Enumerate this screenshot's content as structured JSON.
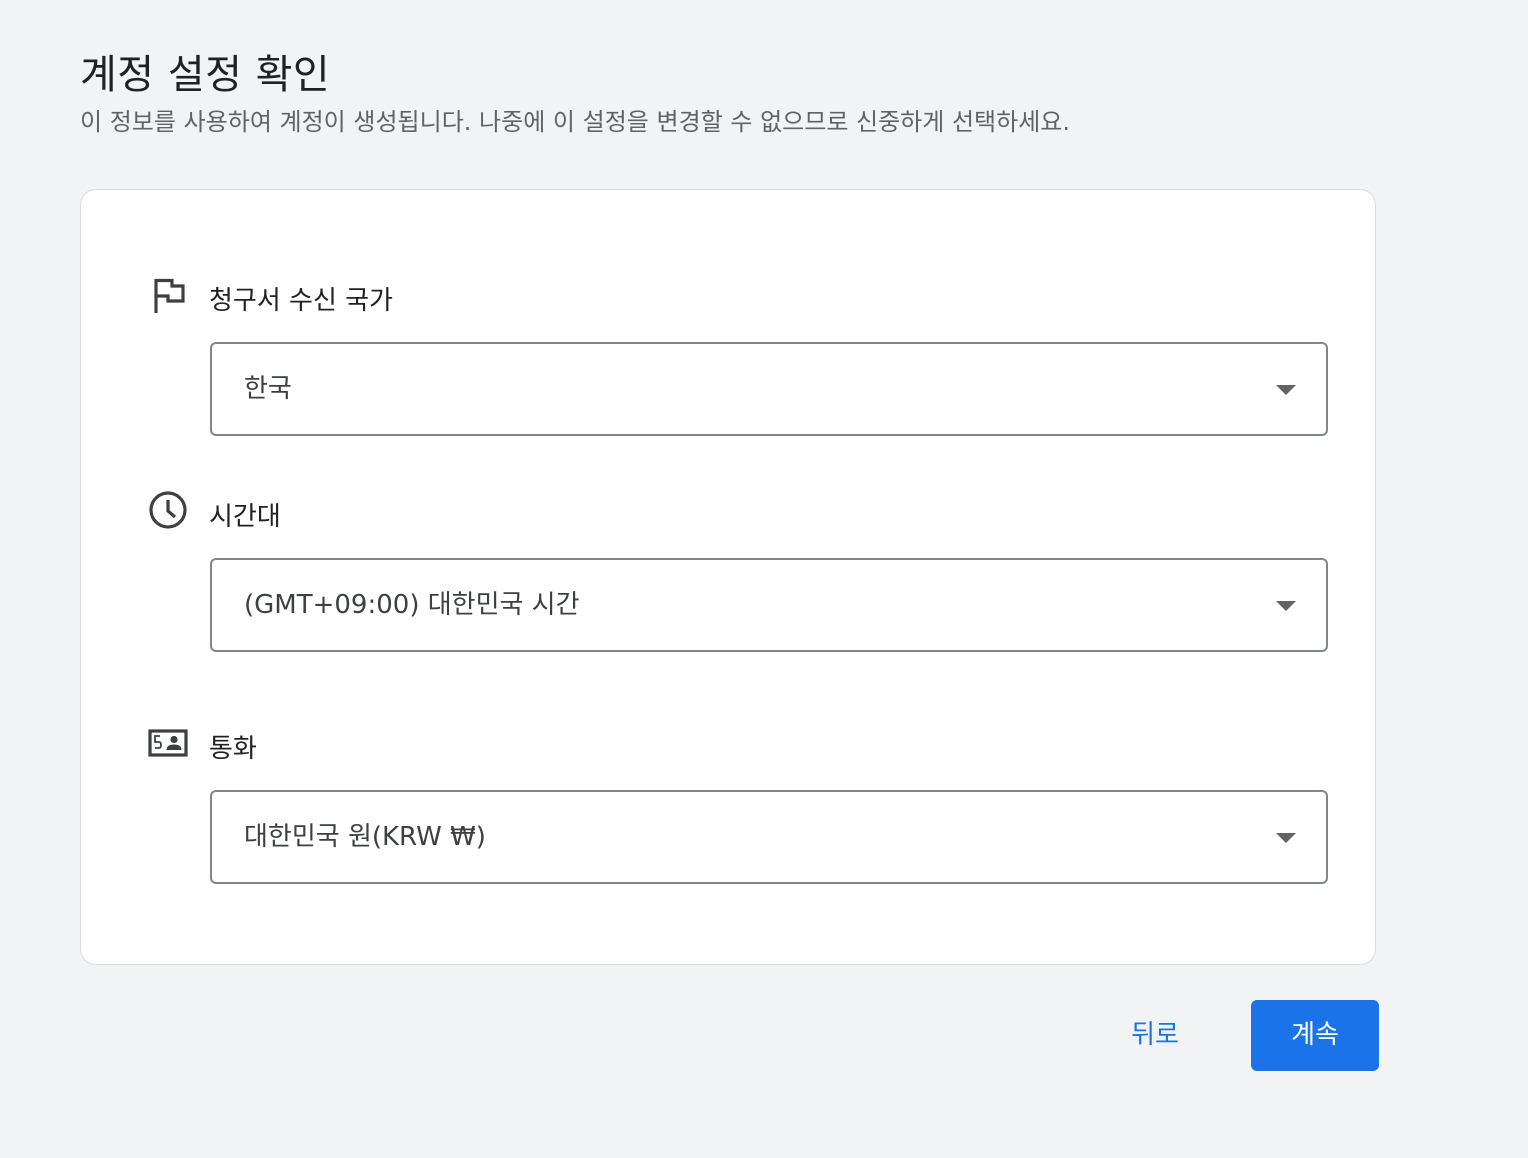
{
  "header": {
    "title": "계정 설정 확인",
    "subtitle": "이 정보를 사용하여 계정이 생성됩니다. 나중에 이 설정을 변경할 수 없으므로 신중하게 선택하세요."
  },
  "sections": {
    "billing_country": {
      "icon": "flag-icon",
      "label": "청구서 수신 국가",
      "value": "한국"
    },
    "timezone": {
      "icon": "clock-icon",
      "label": "시간대",
      "value": "(GMT+09:00) 대한민국 시간"
    },
    "currency": {
      "icon": "currency-icon",
      "label": "통화",
      "value": "대한민국 원(KRW ₩)"
    }
  },
  "actions": {
    "back_label": "뒤로",
    "continue_label": "계속"
  },
  "colors": {
    "accent": "#1a73e8",
    "background": "#f1f3f4",
    "card": "#ffffff",
    "border": "#80868b"
  }
}
